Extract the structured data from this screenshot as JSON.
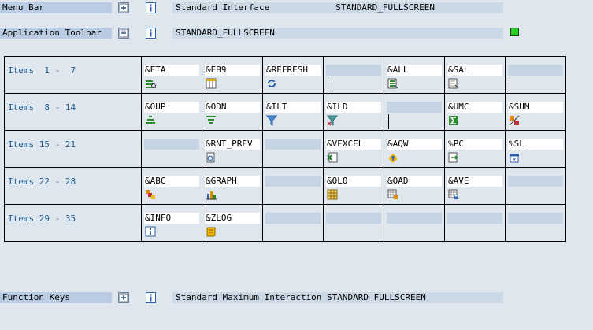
{
  "menu_bar": {
    "label": "Menu Bar",
    "text": "Standard Interface",
    "value": "STANDARD_FULLSCREEN"
  },
  "app_toolbar": {
    "label": "Application Toolbar",
    "value": "STANDARD_FULLSCREEN",
    "status_color": "#22d122"
  },
  "function_keys": {
    "label": "Function Keys",
    "text": "Standard Maximum Interaction STANDARD_FULLSCREEN"
  },
  "rows": [
    {
      "label": "Items  1 -  7",
      "cells": [
        {
          "code": "&ETA",
          "icon": "eta-icon"
        },
        {
          "code": "&EB9",
          "icon": "grid-columns-icon"
        },
        {
          "code": "&REFRESH",
          "icon": "refresh-icon"
        },
        {
          "code": "",
          "icon": ""
        },
        {
          "code": "&ALL",
          "icon": "select-all-icon"
        },
        {
          "code": "&SAL",
          "icon": "deselect-all-icon"
        },
        {
          "code": "",
          "icon": ""
        }
      ]
    },
    {
      "label": "Items  8 - 14",
      "cells": [
        {
          "code": "&OUP",
          "icon": "sort-ascending-icon"
        },
        {
          "code": "&ODN",
          "icon": "sort-descending-icon"
        },
        {
          "code": "&ILT",
          "icon": "filter-icon"
        },
        {
          "code": "&ILD",
          "icon": "delete-filter-icon"
        },
        {
          "code": "",
          "icon": ""
        },
        {
          "code": "&UMC",
          "icon": "sum-icon"
        },
        {
          "code": "&SUM",
          "icon": "subtotal-icon"
        }
      ]
    },
    {
      "label": "Items 15 - 21",
      "cells": [
        {
          "code": "",
          "icon": ""
        },
        {
          "code": "&RNT_PREV",
          "icon": "print-preview-icon"
        },
        {
          "code": "",
          "icon": ""
        },
        {
          "code": "&VEXCEL",
          "icon": "excel-icon"
        },
        {
          "code": "&AQW",
          "icon": "word-processing-icon"
        },
        {
          "code": "%PC",
          "icon": "local-file-icon"
        },
        {
          "code": "%SL",
          "icon": "mail-recipient-icon"
        }
      ]
    },
    {
      "label": "Items 22 - 28",
      "cells": [
        {
          "code": "&ABC",
          "icon": "abc-analysis-icon"
        },
        {
          "code": "&GRAPH",
          "icon": "graphic-icon"
        },
        {
          "code": "",
          "icon": ""
        },
        {
          "code": "&OL0",
          "icon": "change-layout-icon"
        },
        {
          "code": "&OAD",
          "icon": "select-layout-icon"
        },
        {
          "code": "&AVE",
          "icon": "save-layout-icon"
        },
        {
          "code": "",
          "icon": ""
        }
      ]
    },
    {
      "label": "Items 29 - 35",
      "cells": [
        {
          "code": "&INFO",
          "icon": "info-icon"
        },
        {
          "code": "&ZLOG",
          "icon": "log-icon"
        },
        {
          "code": "",
          "icon": ""
        },
        {
          "code": "",
          "icon": ""
        },
        {
          "code": "",
          "icon": ""
        },
        {
          "code": "",
          "icon": ""
        },
        {
          "code": "",
          "icon": ""
        }
      ]
    }
  ]
}
